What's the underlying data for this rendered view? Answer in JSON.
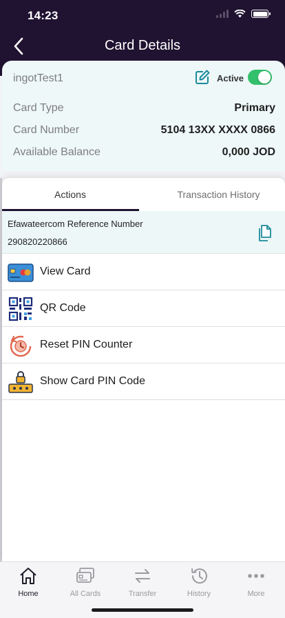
{
  "status_bar": {
    "time": "14:23"
  },
  "header": {
    "title": "Card Details"
  },
  "card": {
    "name": "ingotTest1",
    "status_label": "Active",
    "status_on": true,
    "rows": [
      {
        "label": "Card Type",
        "value": "Primary"
      },
      {
        "label": "Card Number",
        "value": "5104 13XX XXXX 0866"
      },
      {
        "label": "Available Balance",
        "value": "0,000 JOD"
      }
    ]
  },
  "tabs": [
    {
      "label": "Actions",
      "selected": true
    },
    {
      "label": "Transaction History",
      "selected": false
    }
  ],
  "reference": {
    "label": "Efawateercom Reference Number",
    "value": "290820220866"
  },
  "actions": [
    {
      "label": "View Card",
      "icon": "card-icon"
    },
    {
      "label": "QR Code",
      "icon": "qr-code-icon"
    },
    {
      "label": "Reset PIN Counter",
      "icon": "reset-pin-icon"
    },
    {
      "label": "Show Card PIN Code",
      "icon": "pin-code-icon"
    }
  ],
  "bottom_nav": [
    {
      "label": "Home",
      "icon": "home-icon",
      "active": true
    },
    {
      "label": "All Cards",
      "icon": "cards-icon",
      "active": false
    },
    {
      "label": "Transfer",
      "icon": "transfer-icon",
      "active": false
    },
    {
      "label": "History",
      "icon": "history-icon",
      "active": false
    },
    {
      "label": "More",
      "icon": "more-icon",
      "active": false
    }
  ],
  "colors": {
    "header_bg": "#201331",
    "card_bg": "#eef8f8",
    "toggle_on": "#33c06c",
    "accent_teal": "#1b8a9a"
  }
}
